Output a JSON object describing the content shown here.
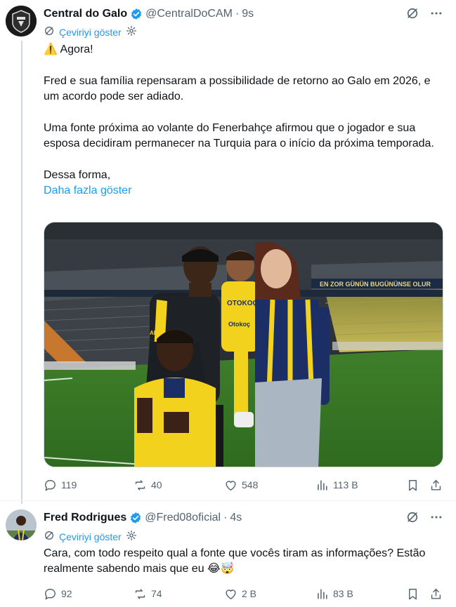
{
  "tweet1": {
    "display_name": "Central do Galo",
    "handle": "@CentralDoCAM",
    "separator": "·",
    "time": "9s",
    "translate_label": "Çeviriyi göster",
    "text": {
      "p1_emoji": "⚠️",
      "p1": "Agora!",
      "p2": "Fred e sua família repensaram a possibilidade de retorno ao Galo em 2026, e um acordo pode ser adiado.",
      "p3": "Uma fonte próxima ao volante do Fenerbahçe afirmou que o jogador e sua esposa decidiram permanecer na Turquia para o início da próxima temporada.",
      "p4": "Dessa forma,"
    },
    "show_more_label": "Daha fazla göster",
    "photo": {
      "banner_text": "EN ZOR GÜNÜN BUGÜNÜNSE OLUR",
      "sponsor_text": "Otokoç",
      "shirt_text_1": "OTOKOÇ",
      "shirt_text_2": "ALPA"
    },
    "stats": {
      "replies": "119",
      "reposts": "40",
      "likes": "548",
      "views": "113 B"
    }
  },
  "tweet2": {
    "display_name": "Fred Rodrigues",
    "handle": "@Fred08oficial",
    "separator": "·",
    "time": "4s",
    "translate_label": "Çeviriyi göster",
    "text": "Cara, com todo respeito qual a fonte que vocês tiram as informações? Estão realmente sabendo mais que eu 😂🤯",
    "stats": {
      "replies": "92",
      "reposts": "74",
      "likes": "2 B",
      "views": "83 B"
    }
  },
  "colors": {
    "accent": "#1d9bf0",
    "text": "#0f1419",
    "muted": "#536471",
    "line": "#cfd9de"
  },
  "icons": [
    "verified-badge-icon",
    "translate-icon",
    "more-icon",
    "gear-icon",
    "reply-icon",
    "repost-icon",
    "like-icon",
    "views-icon",
    "bookmark-icon",
    "share-icon"
  ]
}
